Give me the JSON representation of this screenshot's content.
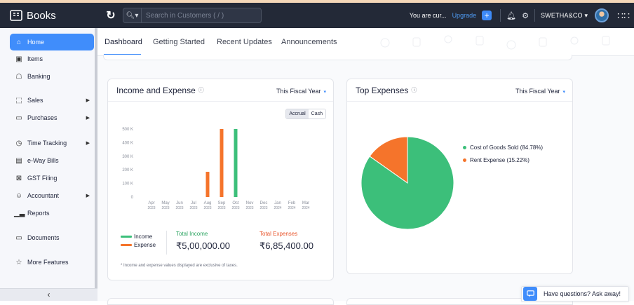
{
  "app": {
    "name": "Books",
    "search_placeholder": "Search in Customers ( / )",
    "trial_text": "You are cur...",
    "upgrade_label": "Upgrade",
    "org_name": "SWETHA&CO",
    "accent": "#408dfb",
    "topbar_bg": "#232937"
  },
  "sidebar": {
    "items": [
      {
        "label": "Home",
        "icon": "home-icon",
        "active": true
      },
      {
        "label": "Items",
        "icon": "items-icon"
      },
      {
        "label": "Banking",
        "icon": "bank-icon"
      },
      {
        "label": "Sales",
        "icon": "cart-icon",
        "has_children": true
      },
      {
        "label": "Purchases",
        "icon": "bag-icon",
        "has_children": true
      },
      {
        "label": "Time Tracking",
        "icon": "timer-icon",
        "has_children": true
      },
      {
        "label": "e-Way Bills",
        "icon": "truck-icon"
      },
      {
        "label": "GST Filing",
        "icon": "gst-icon"
      },
      {
        "label": "Accountant",
        "icon": "accountant-icon",
        "has_children": true
      },
      {
        "label": "Reports",
        "icon": "reports-icon"
      },
      {
        "label": "Documents",
        "icon": "folder-icon"
      },
      {
        "label": "More Features",
        "icon": "star-icon"
      }
    ],
    "collapse_icon": "chevron-left-icon"
  },
  "tabs": [
    {
      "label": "Dashboard",
      "active": true
    },
    {
      "label": "Getting Started"
    },
    {
      "label": "Recent Updates"
    },
    {
      "label": "Announcements"
    }
  ],
  "income_expense": {
    "title": "Income and Expense",
    "period": "This Fiscal Year",
    "toggle": {
      "accrual": "Accrual",
      "cash": "Cash"
    },
    "legend": {
      "income": "Income",
      "expense": "Expense"
    },
    "total_income_label": "Total Income",
    "total_income": "₹5,00,000.00",
    "total_expense_label": "Total Expenses",
    "total_expense": "₹6,85,400.00",
    "footnote": "* Income and expense values displayed are exclusive of taxes.",
    "income_color": "#3cbf7a",
    "expense_color": "#f5742b"
  },
  "top_expenses": {
    "title": "Top Expenses",
    "period": "This Fiscal Year",
    "legend": [
      {
        "label": "Cost of Goods Sold (84.78%)",
        "color": "#3cbf7a"
      },
      {
        "label": "Rent Expense (15.22%)",
        "color": "#f5742b"
      }
    ]
  },
  "help_chat": {
    "label": "Have questions? Ask away!"
  },
  "chart_data": [
    {
      "type": "bar",
      "title": "Income and Expense",
      "categories": [
        "Apr 2023",
        "May 2023",
        "Jun 2023",
        "Jul 2023",
        "Aug 2023",
        "Sep 2023",
        "Oct 2023",
        "Nov 2023",
        "Dec 2023",
        "Jan 2024",
        "Feb 2024",
        "Mar 2024"
      ],
      "category_ticks": [
        {
          "m": "Apr",
          "y": "2023"
        },
        {
          "m": "May",
          "y": "2023"
        },
        {
          "m": "Jun",
          "y": "2023"
        },
        {
          "m": "Jul",
          "y": "2023"
        },
        {
          "m": "Aug",
          "y": "2023"
        },
        {
          "m": "Sep",
          "y": "2023"
        },
        {
          "m": "Oct",
          "y": "2023"
        },
        {
          "m": "Nov",
          "y": "2023"
        },
        {
          "m": "Dec",
          "y": "2023"
        },
        {
          "m": "Jan",
          "y": "2024"
        },
        {
          "m": "Feb",
          "y": "2024"
        },
        {
          "m": "Mar",
          "y": "2024"
        }
      ],
      "series": [
        {
          "name": "Income",
          "color": "#3cbf7a",
          "values": [
            0,
            0,
            0,
            0,
            0,
            0,
            500000,
            0,
            0,
            0,
            0,
            0
          ]
        },
        {
          "name": "Expense",
          "color": "#f5742b",
          "values": [
            0,
            0,
            0,
            0,
            185400,
            500000,
            0,
            0,
            0,
            0,
            0,
            0
          ]
        }
      ],
      "y_ticks": [
        "0",
        "100 K",
        "200 K",
        "300 K",
        "400 K",
        "500 K"
      ],
      "ylim": [
        0,
        500000
      ],
      "grid": false
    },
    {
      "type": "pie",
      "title": "Top Expenses",
      "labels": [
        "Cost of Goods Sold",
        "Rent Expense"
      ],
      "values": [
        84.78,
        15.22
      ],
      "colors": [
        "#3cbf7a",
        "#f5742b"
      ],
      "legend_position": "right"
    }
  ]
}
